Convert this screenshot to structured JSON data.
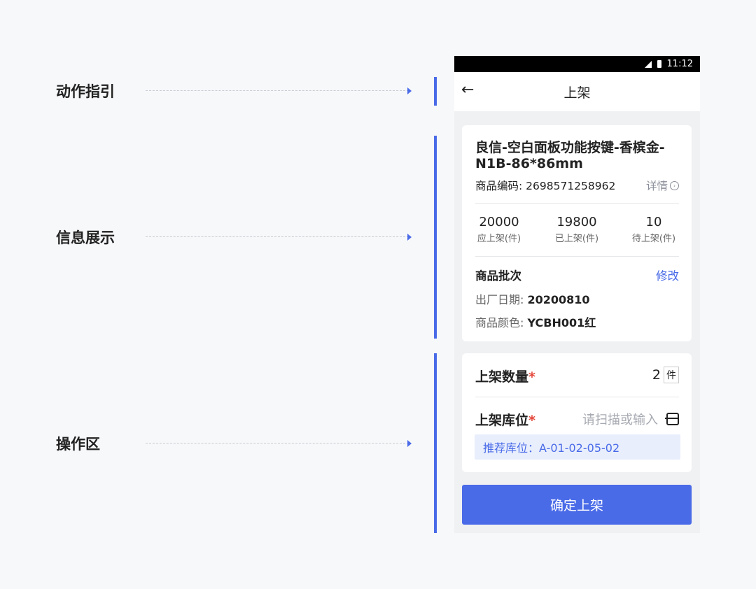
{
  "annotations": [
    {
      "label": "动作指引"
    },
    {
      "label": "信息展示"
    },
    {
      "label": "操作区"
    }
  ],
  "phone": {
    "status_bar": {
      "time": "11:12"
    },
    "nav": {
      "back_icon": "←",
      "title": "上架"
    },
    "product": {
      "name": "良信-空白面板功能按键-香槟金-N1B-86*86mm",
      "code": "商品编码: 2698571258962",
      "detail_label": "详情",
      "detail_icon": "›"
    },
    "stats": [
      {
        "value": "20000",
        "label": "应上架(件)"
      },
      {
        "value": "19800",
        "label": "已上架(件)"
      },
      {
        "value": "10",
        "label": "待上架(件)"
      }
    ],
    "batch": {
      "title": "商品批次",
      "edit_label": "修改",
      "fields": [
        {
          "key": "出厂日期:",
          "value": "20200810"
        },
        {
          "key": "商品颜色:",
          "value": "YCBH001红"
        }
      ]
    },
    "operation": {
      "quantity_label": "上架数量",
      "required_mark": "*",
      "quantity_value": "2",
      "quantity_unit": "件",
      "location_label": "上架库位",
      "location_placeholder": "请扫描或输入",
      "recommend": "推荐库位：A-01-02-05-02"
    },
    "confirm_label": "确定上架"
  },
  "colors": {
    "accent": "#4a6be8",
    "required": "#e5483c",
    "background": "#f7f8fa"
  }
}
